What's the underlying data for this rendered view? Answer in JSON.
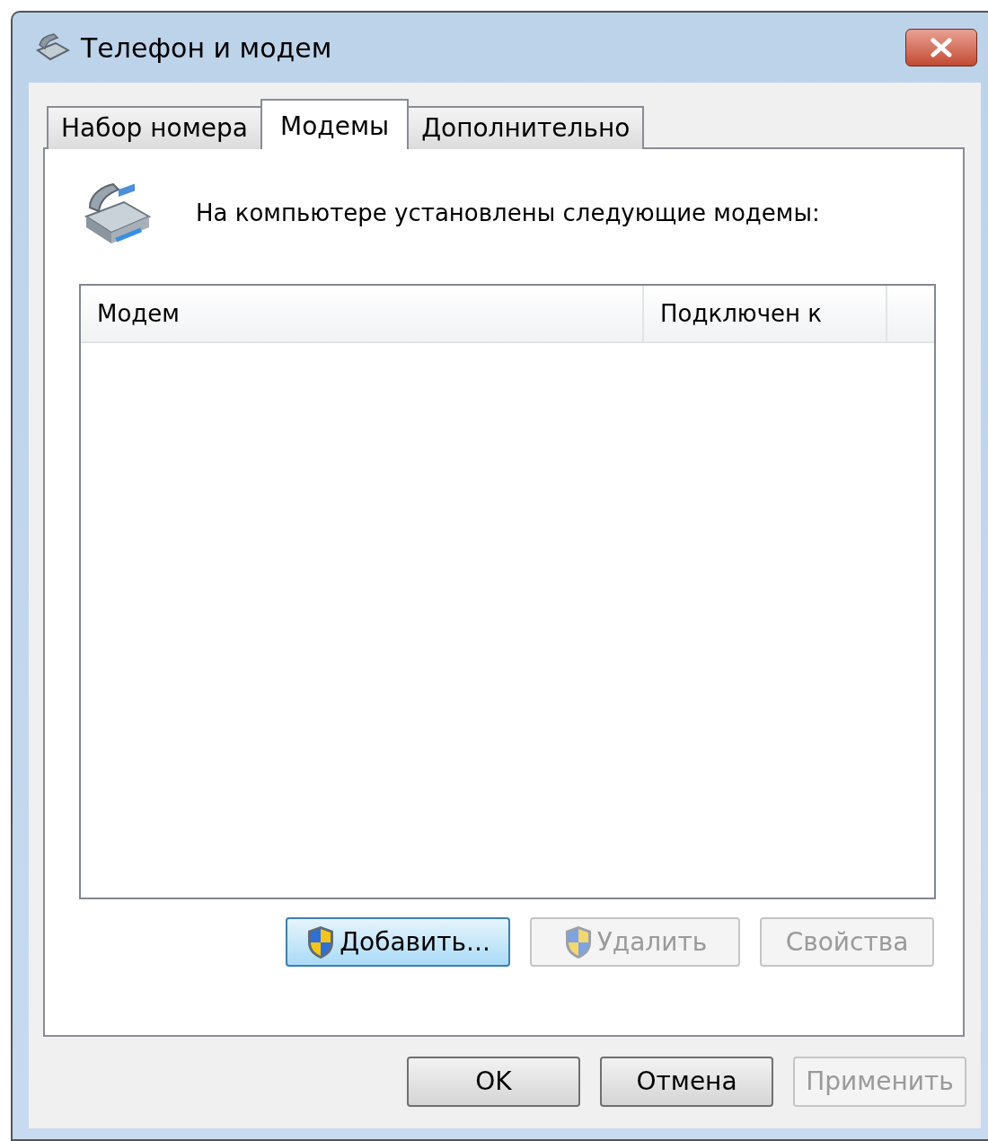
{
  "window": {
    "title": "Телефон и модем"
  },
  "tabs": [
    {
      "label": "Набор номера",
      "selected": false
    },
    {
      "label": "Модемы",
      "selected": true
    },
    {
      "label": "Дополнительно",
      "selected": false
    }
  ],
  "intro": "На компьютере установлены следующие модемы:",
  "table": {
    "columns": [
      "Модем",
      "Подключен к"
    ]
  },
  "list_buttons": [
    {
      "label": "Добавить...",
      "shield": true,
      "disabled": false,
      "focused": true
    },
    {
      "label": "Удалить",
      "shield": true,
      "disabled": true,
      "focused": false
    },
    {
      "label": "Свойства",
      "shield": false,
      "disabled": true,
      "focused": false
    }
  ],
  "dialog_buttons": [
    {
      "label": "OK",
      "disabled": false
    },
    {
      "label": "Отмена",
      "disabled": false
    },
    {
      "label": "Применить",
      "disabled": true
    }
  ]
}
